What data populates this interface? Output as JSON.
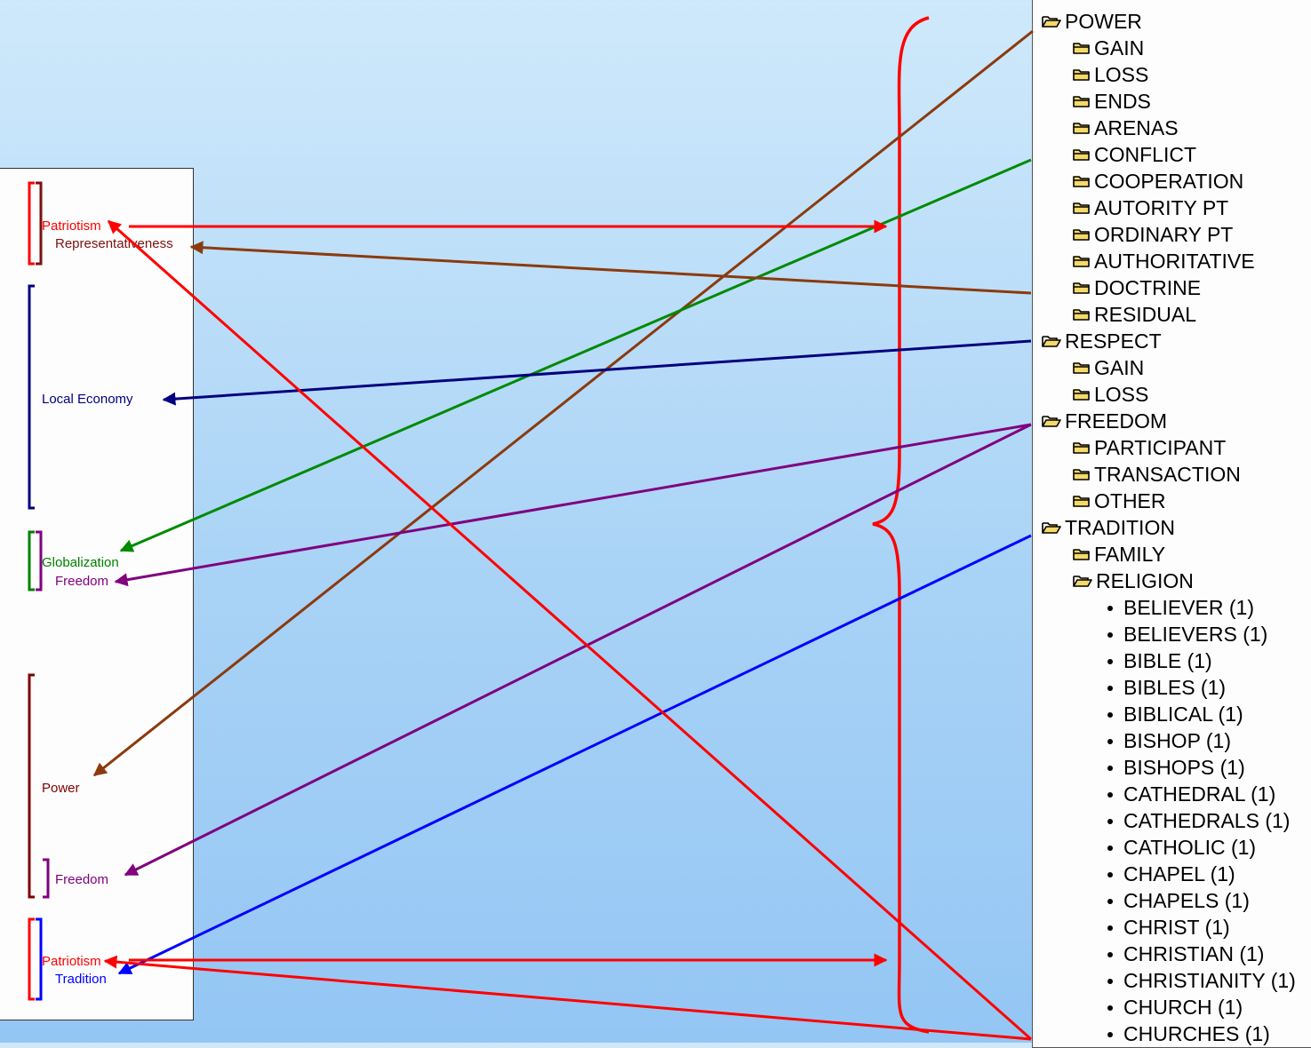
{
  "left_panel": {
    "groups": [
      {
        "name": "patriotism-1",
        "label": "Patriotism",
        "color": "#ff0000"
      },
      {
        "name": "representativeness",
        "label": "Representativeness",
        "color": "#7b1010"
      },
      {
        "name": "local-economy",
        "label": "Local Economy",
        "color": "#000080"
      },
      {
        "name": "globalization",
        "label": "Globalization",
        "color": "#008000"
      },
      {
        "name": "freedom-1",
        "label": "Freedom",
        "color": "#800080"
      },
      {
        "name": "power",
        "label": "Power",
        "color": "#800000"
      },
      {
        "name": "freedom-2",
        "label": "Freedom",
        "color": "#800080"
      },
      {
        "name": "patriotism-2",
        "label": "Patriotism",
        "color": "#ff0000"
      },
      {
        "name": "tradition",
        "label": "Tradition",
        "color": "#0000ff"
      }
    ]
  },
  "tree": {
    "items": [
      {
        "label": "POWER",
        "level": 0,
        "icon": "folder-open-icon"
      },
      {
        "label": "GAIN",
        "level": 1,
        "icon": "folder-closed-icon"
      },
      {
        "label": "LOSS",
        "level": 1,
        "icon": "folder-closed-icon"
      },
      {
        "label": "ENDS",
        "level": 1,
        "icon": "folder-closed-icon"
      },
      {
        "label": "ARENAS",
        "level": 1,
        "icon": "folder-closed-icon"
      },
      {
        "label": "CONFLICT",
        "level": 1,
        "icon": "folder-closed-icon"
      },
      {
        "label": "COOPERATION",
        "level": 1,
        "icon": "folder-closed-icon"
      },
      {
        "label": "AUTORITY PT",
        "level": 1,
        "icon": "folder-closed-icon"
      },
      {
        "label": "ORDINARY PT",
        "level": 1,
        "icon": "folder-closed-icon"
      },
      {
        "label": "AUTHORITATIVE",
        "level": 1,
        "icon": "folder-closed-icon"
      },
      {
        "label": "DOCTRINE",
        "level": 1,
        "icon": "folder-closed-icon"
      },
      {
        "label": "RESIDUAL",
        "level": 1,
        "icon": "folder-closed-icon"
      },
      {
        "label": "RESPECT",
        "level": 0,
        "icon": "folder-open-icon"
      },
      {
        "label": "GAIN",
        "level": 1,
        "icon": "folder-closed-icon"
      },
      {
        "label": "LOSS",
        "level": 1,
        "icon": "folder-closed-icon"
      },
      {
        "label": "FREEDOM",
        "level": 0,
        "icon": "folder-open-icon"
      },
      {
        "label": "PARTICIPANT",
        "level": 1,
        "icon": "folder-closed-icon"
      },
      {
        "label": "TRANSACTION",
        "level": 1,
        "icon": "folder-closed-icon"
      },
      {
        "label": "OTHER",
        "level": 1,
        "icon": "folder-closed-icon"
      },
      {
        "label": "TRADITION",
        "level": 0,
        "icon": "folder-open-icon"
      },
      {
        "label": "FAMILY",
        "level": 1,
        "icon": "folder-closed-icon"
      },
      {
        "label": "RELIGION",
        "level": 1,
        "icon": "folder-open-icon"
      },
      {
        "label": "BELIEVER (1)",
        "level": 2,
        "icon": "bullet"
      },
      {
        "label": "BELIEVERS (1)",
        "level": 2,
        "icon": "bullet"
      },
      {
        "label": "BIBLE (1)",
        "level": 2,
        "icon": "bullet"
      },
      {
        "label": "BIBLES (1)",
        "level": 2,
        "icon": "bullet"
      },
      {
        "label": "BIBLICAL (1)",
        "level": 2,
        "icon": "bullet"
      },
      {
        "label": "BISHOP (1)",
        "level": 2,
        "icon": "bullet"
      },
      {
        "label": "BISHOPS (1)",
        "level": 2,
        "icon": "bullet"
      },
      {
        "label": "CATHEDRAL (1)",
        "level": 2,
        "icon": "bullet"
      },
      {
        "label": "CATHEDRALS (1)",
        "level": 2,
        "icon": "bullet"
      },
      {
        "label": "CATHOLIC (1)",
        "level": 2,
        "icon": "bullet"
      },
      {
        "label": "CHAPEL (1)",
        "level": 2,
        "icon": "bullet"
      },
      {
        "label": "CHAPELS (1)",
        "level": 2,
        "icon": "bullet"
      },
      {
        "label": "CHRIST (1)",
        "level": 2,
        "icon": "bullet"
      },
      {
        "label": "CHRISTIAN (1)",
        "level": 2,
        "icon": "bullet"
      },
      {
        "label": "CHRISTIANITY (1)",
        "level": 2,
        "icon": "bullet"
      },
      {
        "label": "CHURCH (1)",
        "level": 2,
        "icon": "bullet"
      },
      {
        "label": "CHURCHES (1)",
        "level": 2,
        "icon": "bullet"
      }
    ]
  },
  "connectors": [
    {
      "name": "power-to-power",
      "color": "#8b3a0e"
    },
    {
      "name": "globalization-link",
      "color": "#008a00"
    },
    {
      "name": "doctrine-to-representativeness",
      "color": "#8b3a0e"
    },
    {
      "name": "respect-to-local-economy",
      "color": "#000080"
    },
    {
      "name": "freedom-to-freedom-1",
      "color": "#800080"
    },
    {
      "name": "freedom-to-freedom-2",
      "color": "#800080"
    },
    {
      "name": "tradition-link",
      "color": "#0000ff"
    },
    {
      "name": "patriotism-top-to-brace",
      "color": "#ff0000"
    },
    {
      "name": "patriotism-bottom-to-brace",
      "color": "#ff0000"
    },
    {
      "name": "churches-to-patriotism-top",
      "color": "#ff0000"
    },
    {
      "name": "churches-to-patriotism-bottom",
      "color": "#ff0000"
    }
  ],
  "brace": {
    "color": "#ff0000"
  }
}
